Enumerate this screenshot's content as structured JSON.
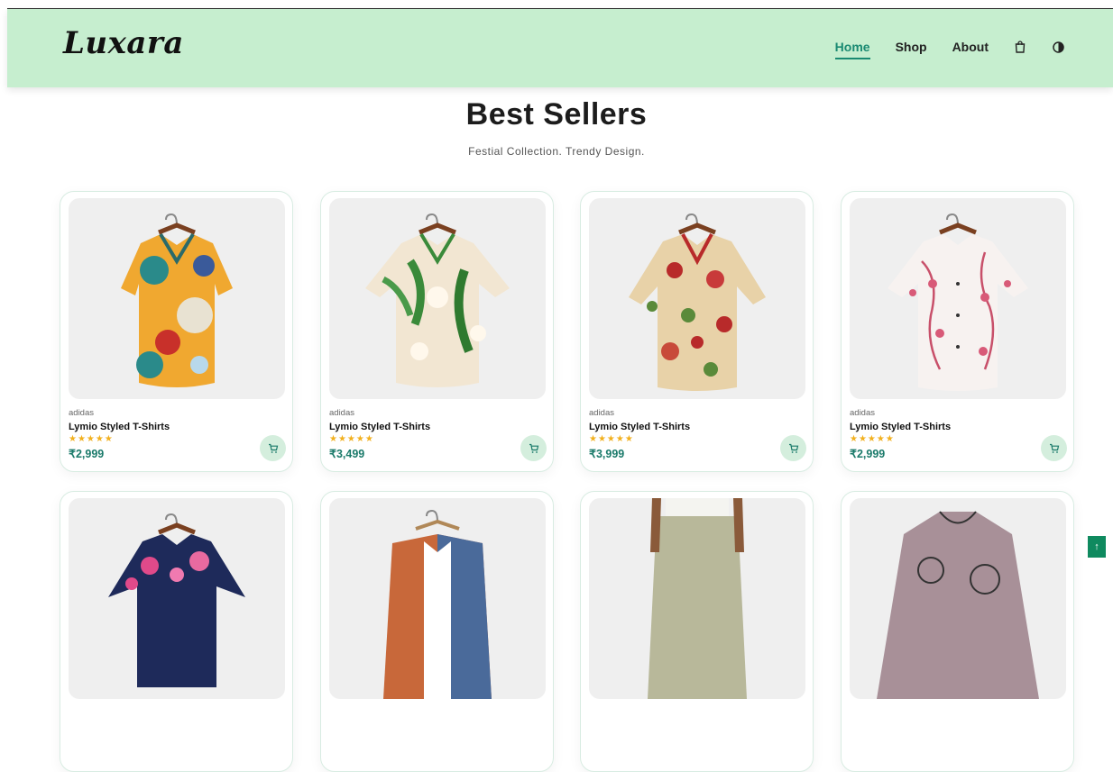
{
  "brand": {
    "logo_text": "Luxara"
  },
  "nav": {
    "links": [
      {
        "label": "Home",
        "active": true
      },
      {
        "label": "Shop",
        "active": false
      },
      {
        "label": "About",
        "active": false
      }
    ],
    "icons": [
      "shopping-bag-icon",
      "theme-toggle-icon"
    ]
  },
  "section": {
    "title": "Best Sellers",
    "subtitle": "Festial Collection. Trendy Design."
  },
  "products": [
    {
      "brand": "adidas",
      "name": "Lymio Styled T-Shirts",
      "rating": "★★★★★",
      "price": "₹2,999",
      "image": "abstract-print-shirt"
    },
    {
      "brand": "adidas",
      "name": "Lymio Styled T-Shirts",
      "rating": "★★★★★",
      "price": "₹3,499",
      "image": "tropical-leaf-shirt"
    },
    {
      "brand": "adidas",
      "name": "Lymio Styled T-Shirts",
      "rating": "★★★★★",
      "price": "₹3,999",
      "image": "floral-beige-shirt"
    },
    {
      "brand": "adidas",
      "name": "Lymio Styled T-Shirts",
      "rating": "★★★★★",
      "price": "₹2,999",
      "image": "blossom-white-shirt"
    }
  ],
  "products_row2": [
    {
      "image": "navy-floral-shirt"
    },
    {
      "image": "orange-denim-jacket"
    },
    {
      "image": "linen-pants"
    },
    {
      "image": "printed-top"
    }
  ],
  "colors": {
    "accent": "#1a8a72",
    "header_bg": "#c6eecf",
    "star": "#f2b01e",
    "price": "#1a7a6a"
  },
  "scroll_top": {
    "label": "↑"
  }
}
